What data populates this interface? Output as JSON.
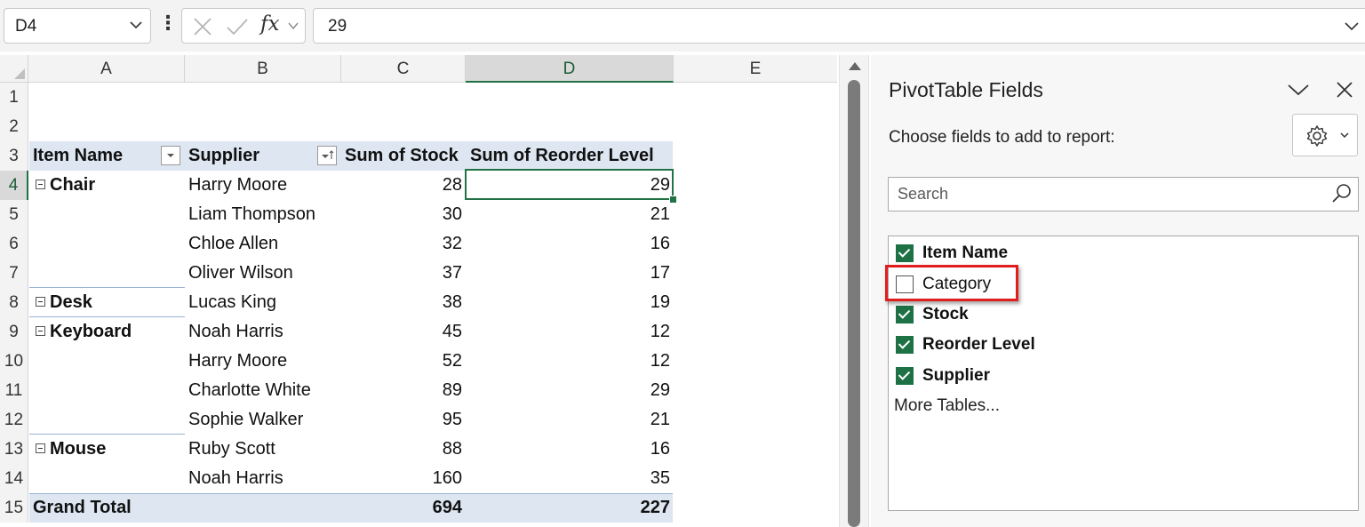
{
  "formula_bar": {
    "name_box": "D4",
    "formula_value": "29",
    "fx_label": "fx"
  },
  "sheet": {
    "columns": [
      "A",
      "B",
      "C",
      "D",
      "E"
    ],
    "selected_column": "D",
    "rows": [
      "1",
      "2",
      "3",
      "4",
      "5",
      "6",
      "7",
      "8",
      "9",
      "10",
      "11",
      "12",
      "13",
      "14",
      "15"
    ],
    "selected_row": "4",
    "pivot": {
      "headers": {
        "item_name": "Item Name",
        "supplier": "Supplier",
        "sum_stock": "Sum of Stock",
        "sum_reorder": "Sum of Reorder Level"
      },
      "rows": [
        {
          "item": "Chair",
          "supplier": "Harry Moore",
          "stock": "28",
          "reorder": "29"
        },
        {
          "item": "",
          "supplier": "Liam Thompson",
          "stock": "30",
          "reorder": "21"
        },
        {
          "item": "",
          "supplier": "Chloe Allen",
          "stock": "32",
          "reorder": "16"
        },
        {
          "item": "",
          "supplier": "Oliver Wilson",
          "stock": "37",
          "reorder": "17"
        },
        {
          "item": "Desk",
          "supplier": "Lucas King",
          "stock": "38",
          "reorder": "19"
        },
        {
          "item": "Keyboard",
          "supplier": "Noah Harris",
          "stock": "45",
          "reorder": "12"
        },
        {
          "item": "",
          "supplier": "Harry Moore",
          "stock": "52",
          "reorder": "12"
        },
        {
          "item": "",
          "supplier": "Charlotte White",
          "stock": "89",
          "reorder": "29"
        },
        {
          "item": "",
          "supplier": "Sophie Walker",
          "stock": "95",
          "reorder": "21"
        },
        {
          "item": "Mouse",
          "supplier": "Ruby Scott",
          "stock": "88",
          "reorder": "16"
        },
        {
          "item": "",
          "supplier": "Noah Harris",
          "stock": "160",
          "reorder": "35"
        }
      ],
      "grand_total": {
        "label": "Grand Total",
        "stock": "694",
        "reorder": "227"
      }
    }
  },
  "pivot_pane": {
    "title": "PivotTable Fields",
    "choose_label": "Choose fields to add to report:",
    "search_placeholder": "Search",
    "fields": [
      {
        "label": "Item Name",
        "checked": true
      },
      {
        "label": "Category",
        "checked": false
      },
      {
        "label": "Stock",
        "checked": true
      },
      {
        "label": "Reorder Level",
        "checked": true
      },
      {
        "label": "Supplier",
        "checked": true
      }
    ],
    "more_tables": "More Tables..."
  },
  "colors": {
    "accent_green": "#217346",
    "pivot_header_band": "#dde6f1",
    "checkbox_green": "#1e7145",
    "highlight_red": "#e01e1e"
  }
}
